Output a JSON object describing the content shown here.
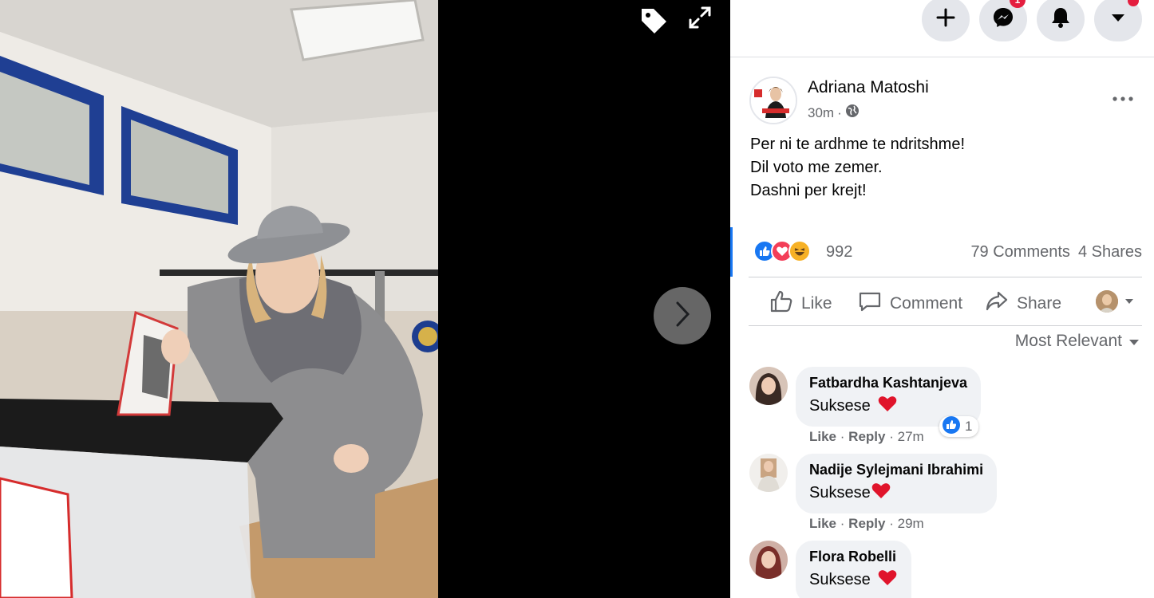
{
  "viewer": {
    "tag_icon": "tag-icon",
    "fullscreen_icon": "fullscreen-icon",
    "next_icon": "chevron-right-icon"
  },
  "topbar": {
    "create_icon": "plus-icon",
    "messenger_icon": "messenger-icon",
    "messenger_badge": "1",
    "notifications_icon": "bell-icon",
    "account_icon": "caret-down-icon"
  },
  "post": {
    "author": "Adriana Matoshi",
    "time": "30m",
    "separator": "·",
    "audience_icon": "globe-icon",
    "lines": [
      "Per ni te ardhme te ndritshme!",
      "Dil voto me zemer.",
      "Dashni per krejt!"
    ],
    "reaction_count": "992",
    "comments_count": "79 Comments",
    "shares_count": "4 Shares"
  },
  "actions": {
    "like": "Like",
    "comment": "Comment",
    "share": "Share"
  },
  "sort_label": "Most Relevant",
  "comments": [
    {
      "name": "Fatbardha Kashtanjeva",
      "text": "Suksese",
      "heart_spaced": true,
      "like": "Like",
      "reply": "Reply",
      "time": "27m",
      "reaction_count": "1"
    },
    {
      "name": "Nadije Sylejmani Ibrahimi",
      "text": "Suksese",
      "heart_spaced": false,
      "like": "Like",
      "reply": "Reply",
      "time": "29m"
    },
    {
      "name": "Flora Robelli",
      "text": "Suksese",
      "heart_spaced": true
    }
  ],
  "colors": {
    "facebook_blue": "#1877f2",
    "badge_red": "#e41e3f",
    "secondary_text": "#65676b",
    "bubble": "#f0f2f5"
  }
}
